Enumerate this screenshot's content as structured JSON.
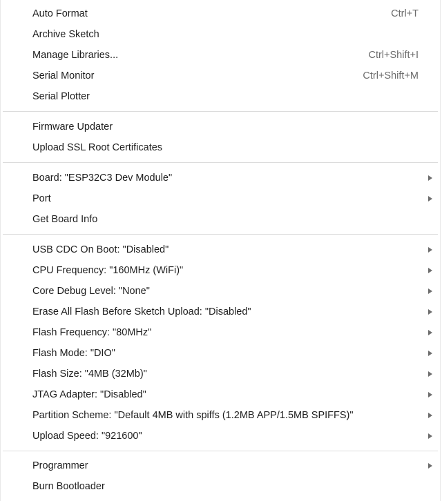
{
  "menu": {
    "items": [
      {
        "label": "Auto Format",
        "shortcut": "Ctrl+T"
      },
      {
        "label": "Archive Sketch"
      },
      {
        "label": "Manage Libraries...",
        "shortcut": "Ctrl+Shift+I"
      },
      {
        "label": "Serial Monitor",
        "shortcut": "Ctrl+Shift+M"
      },
      {
        "label": "Serial Plotter"
      },
      {
        "label": "Firmware Updater"
      },
      {
        "label": "Upload SSL Root Certificates"
      },
      {
        "label": "Board: \"ESP32C3 Dev Module\"",
        "submenu_icon": "chevron-right-icon"
      },
      {
        "label": "Port",
        "submenu_icon": "chevron-right-icon"
      },
      {
        "label": "Get Board Info"
      },
      {
        "label": "USB CDC On Boot: \"Disabled\"",
        "submenu_icon": "chevron-right-icon"
      },
      {
        "label": "CPU Frequency: \"160MHz (WiFi)\"",
        "submenu_icon": "chevron-right-icon"
      },
      {
        "label": "Core Debug Level: \"None\"",
        "submenu_icon": "chevron-right-icon"
      },
      {
        "label": "Erase All Flash Before Sketch Upload: \"Disabled\"",
        "submenu_icon": "chevron-right-icon"
      },
      {
        "label": "Flash Frequency: \"80MHz\"",
        "submenu_icon": "chevron-right-icon"
      },
      {
        "label": "Flash Mode: \"DIO\"",
        "submenu_icon": "chevron-right-icon"
      },
      {
        "label": "Flash Size: \"4MB (32Mb)\"",
        "submenu_icon": "chevron-right-icon"
      },
      {
        "label": "JTAG Adapter: \"Disabled\"",
        "submenu_icon": "chevron-right-icon"
      },
      {
        "label": "Partition Scheme: \"Default 4MB with spiffs (1.2MB APP/1.5MB SPIFFS)\"",
        "submenu_icon": "chevron-right-icon"
      },
      {
        "label": "Upload Speed: \"921600\"",
        "submenu_icon": "chevron-right-icon"
      },
      {
        "label": "Programmer",
        "submenu_icon": "chevron-right-icon"
      },
      {
        "label": "Burn Bootloader"
      }
    ]
  }
}
